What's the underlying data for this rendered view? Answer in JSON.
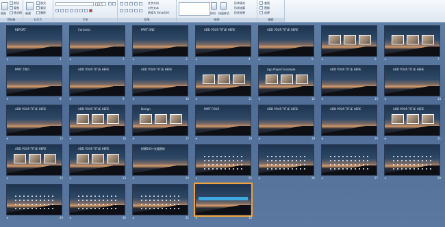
{
  "ribbon": {
    "groups": [
      {
        "label": "剪贴板"
      },
      {
        "label": "幻灯片"
      },
      {
        "label": "字体"
      },
      {
        "label": "段落"
      },
      {
        "label": "绘图"
      },
      {
        "label": "编辑"
      }
    ],
    "clipboard": {
      "paste": "粘贴",
      "cut": "剪切",
      "copy": "复制",
      "format": "格式刷"
    },
    "slides": {
      "new": "新建",
      "layout": "版式",
      "reset": "重设",
      "delete": "删除"
    },
    "font": {
      "font_value": "",
      "size_value": "10.5"
    },
    "paragraph": {
      "text_dir": "文字方向",
      "align": "对齐文本",
      "smartart": "转换为 SmartArt"
    },
    "drawing": {
      "arrange": "排列",
      "quick_styles": "快速样式",
      "fill": "形状填充",
      "outline": "形状轮廓",
      "effects": "形状效果"
    },
    "editing": {
      "find": "查找",
      "replace": "替换",
      "select": "选择"
    }
  },
  "slides": [
    {
      "num": "1",
      "caption": "REPORT"
    },
    {
      "num": "2",
      "caption": "Contents"
    },
    {
      "num": "3",
      "caption": "PART ONE"
    },
    {
      "num": "4",
      "caption": "ADD YOUR TITLE HERE"
    },
    {
      "num": "5",
      "caption": "ADD YOUR TITLE HERE"
    },
    {
      "num": "6",
      "caption": ""
    },
    {
      "num": "7",
      "caption": ""
    },
    {
      "num": "8",
      "caption": "PART TWO"
    },
    {
      "num": "9",
      "caption": "ADD YOUR TITLE HERE"
    },
    {
      "num": "10",
      "caption": "ADD YOUR TITLE HERE"
    },
    {
      "num": "11",
      "caption": ""
    },
    {
      "num": "12",
      "caption": "App Project Example"
    },
    {
      "num": "13",
      "caption": "ADD YOUR TITLE HERE"
    },
    {
      "num": "14",
      "caption": "ADD YOUR TITLE HERE"
    },
    {
      "num": "15",
      "caption": "ADD YOUR TITLE HERE"
    },
    {
      "num": "16",
      "caption": "ADD YOUR TITLE HERE"
    },
    {
      "num": "17",
      "caption": "Design"
    },
    {
      "num": "18",
      "caption": "PART FOUR"
    },
    {
      "num": "19",
      "caption": "ADD YOUR TITLE HERE"
    },
    {
      "num": "20",
      "caption": "ADD YOUR TITLE HERE"
    },
    {
      "num": "21",
      "caption": "ADD YOUR TITLE HERE"
    },
    {
      "num": "22",
      "caption": "ADD YOUR TITLE HERE"
    },
    {
      "num": "23",
      "caption": "ADD YOUR TITLE HERE"
    },
    {
      "num": "24",
      "caption": "附赠500+矢量图标"
    },
    {
      "num": "25",
      "caption": ""
    },
    {
      "num": "26",
      "caption": ""
    },
    {
      "num": "27",
      "caption": ""
    },
    {
      "num": "28",
      "caption": ""
    },
    {
      "num": "29",
      "caption": ""
    },
    {
      "num": "30",
      "caption": ""
    },
    {
      "num": "31",
      "caption": ""
    },
    {
      "num": "32",
      "caption": ""
    }
  ]
}
